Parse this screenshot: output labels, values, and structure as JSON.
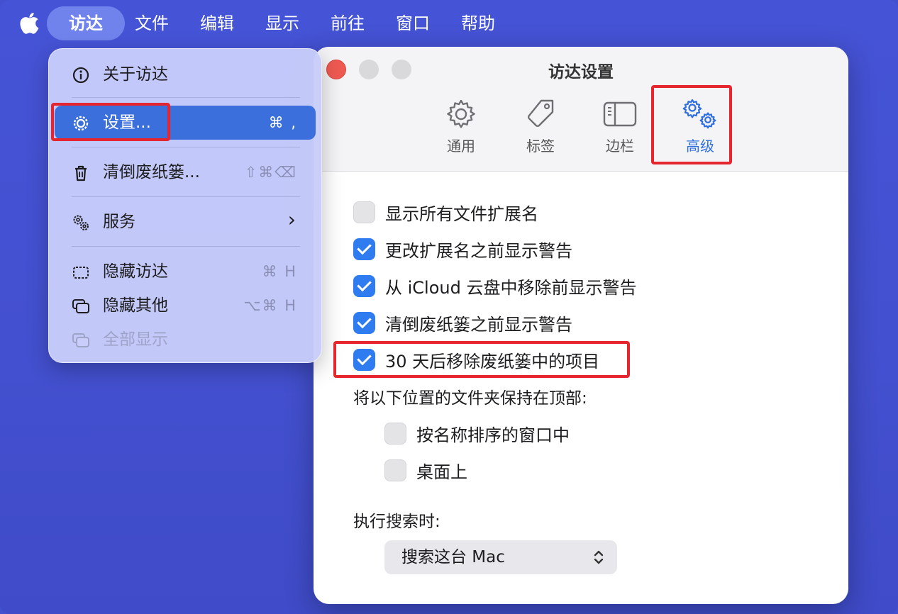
{
  "menubar": {
    "apple_icon": "apple-logo-icon",
    "items": [
      {
        "label": "访达",
        "active": true
      },
      {
        "label": "文件"
      },
      {
        "label": "编辑"
      },
      {
        "label": "显示"
      },
      {
        "label": "前往"
      },
      {
        "label": "窗口"
      },
      {
        "label": "帮助"
      }
    ]
  },
  "menu": {
    "items": [
      {
        "icon": "info-circle-icon",
        "label": "关于访达",
        "shortcut": ""
      },
      {
        "icon": "gear-icon",
        "label": "设置...",
        "shortcut": "⌘ ,",
        "highlighted": true
      },
      {
        "icon": "trash-icon",
        "label": "清倒废纸篓...",
        "shortcut": "⇧⌘⌫"
      },
      {
        "icon": "services-gears-icon",
        "label": "服务",
        "shortcut": "›",
        "submenu": true
      },
      {
        "icon": "hide-window-icon",
        "label": "隐藏访达",
        "shortcut": "⌘ H"
      },
      {
        "icon": "hide-others-icon",
        "label": "隐藏其他",
        "shortcut": "⌥⌘ H"
      },
      {
        "icon": "show-all-icon",
        "label": "全部显示",
        "shortcut": "",
        "disabled": true
      }
    ]
  },
  "window": {
    "title": "访达设置",
    "tabs": [
      {
        "icon": "gear-icon",
        "label": "通用"
      },
      {
        "icon": "tag-icon",
        "label": "标签"
      },
      {
        "icon": "sidebar-icon",
        "label": "边栏"
      },
      {
        "icon": "advanced-gears-icon",
        "label": "高级",
        "selected": true
      }
    ],
    "options": [
      {
        "label": "显示所有文件扩展名",
        "checked": false
      },
      {
        "label": "更改扩展名之前显示警告",
        "checked": true
      },
      {
        "label": "从 iCloud 云盘中移除前显示警告",
        "checked": true
      },
      {
        "label": "清倒废纸篓之前显示警告",
        "checked": true
      },
      {
        "label": "30 天后移除废纸篓中的项目",
        "checked": true
      }
    ],
    "folders_on_top_label": "将以下位置的文件夹保持在顶部:",
    "folders_on_top": [
      {
        "label": "按名称排序的窗口中",
        "checked": false
      },
      {
        "label": "桌面上",
        "checked": false
      }
    ],
    "search_label": "执行搜索时:",
    "search_scope": "搜索这台 Mac"
  },
  "colors": {
    "desktop": "#4350cf",
    "menu_highlight": "#3a6fdc",
    "checkbox_on": "#2f7bf0",
    "annotation_red": "#e5262e",
    "tab_selected": "#2f6fdf"
  }
}
